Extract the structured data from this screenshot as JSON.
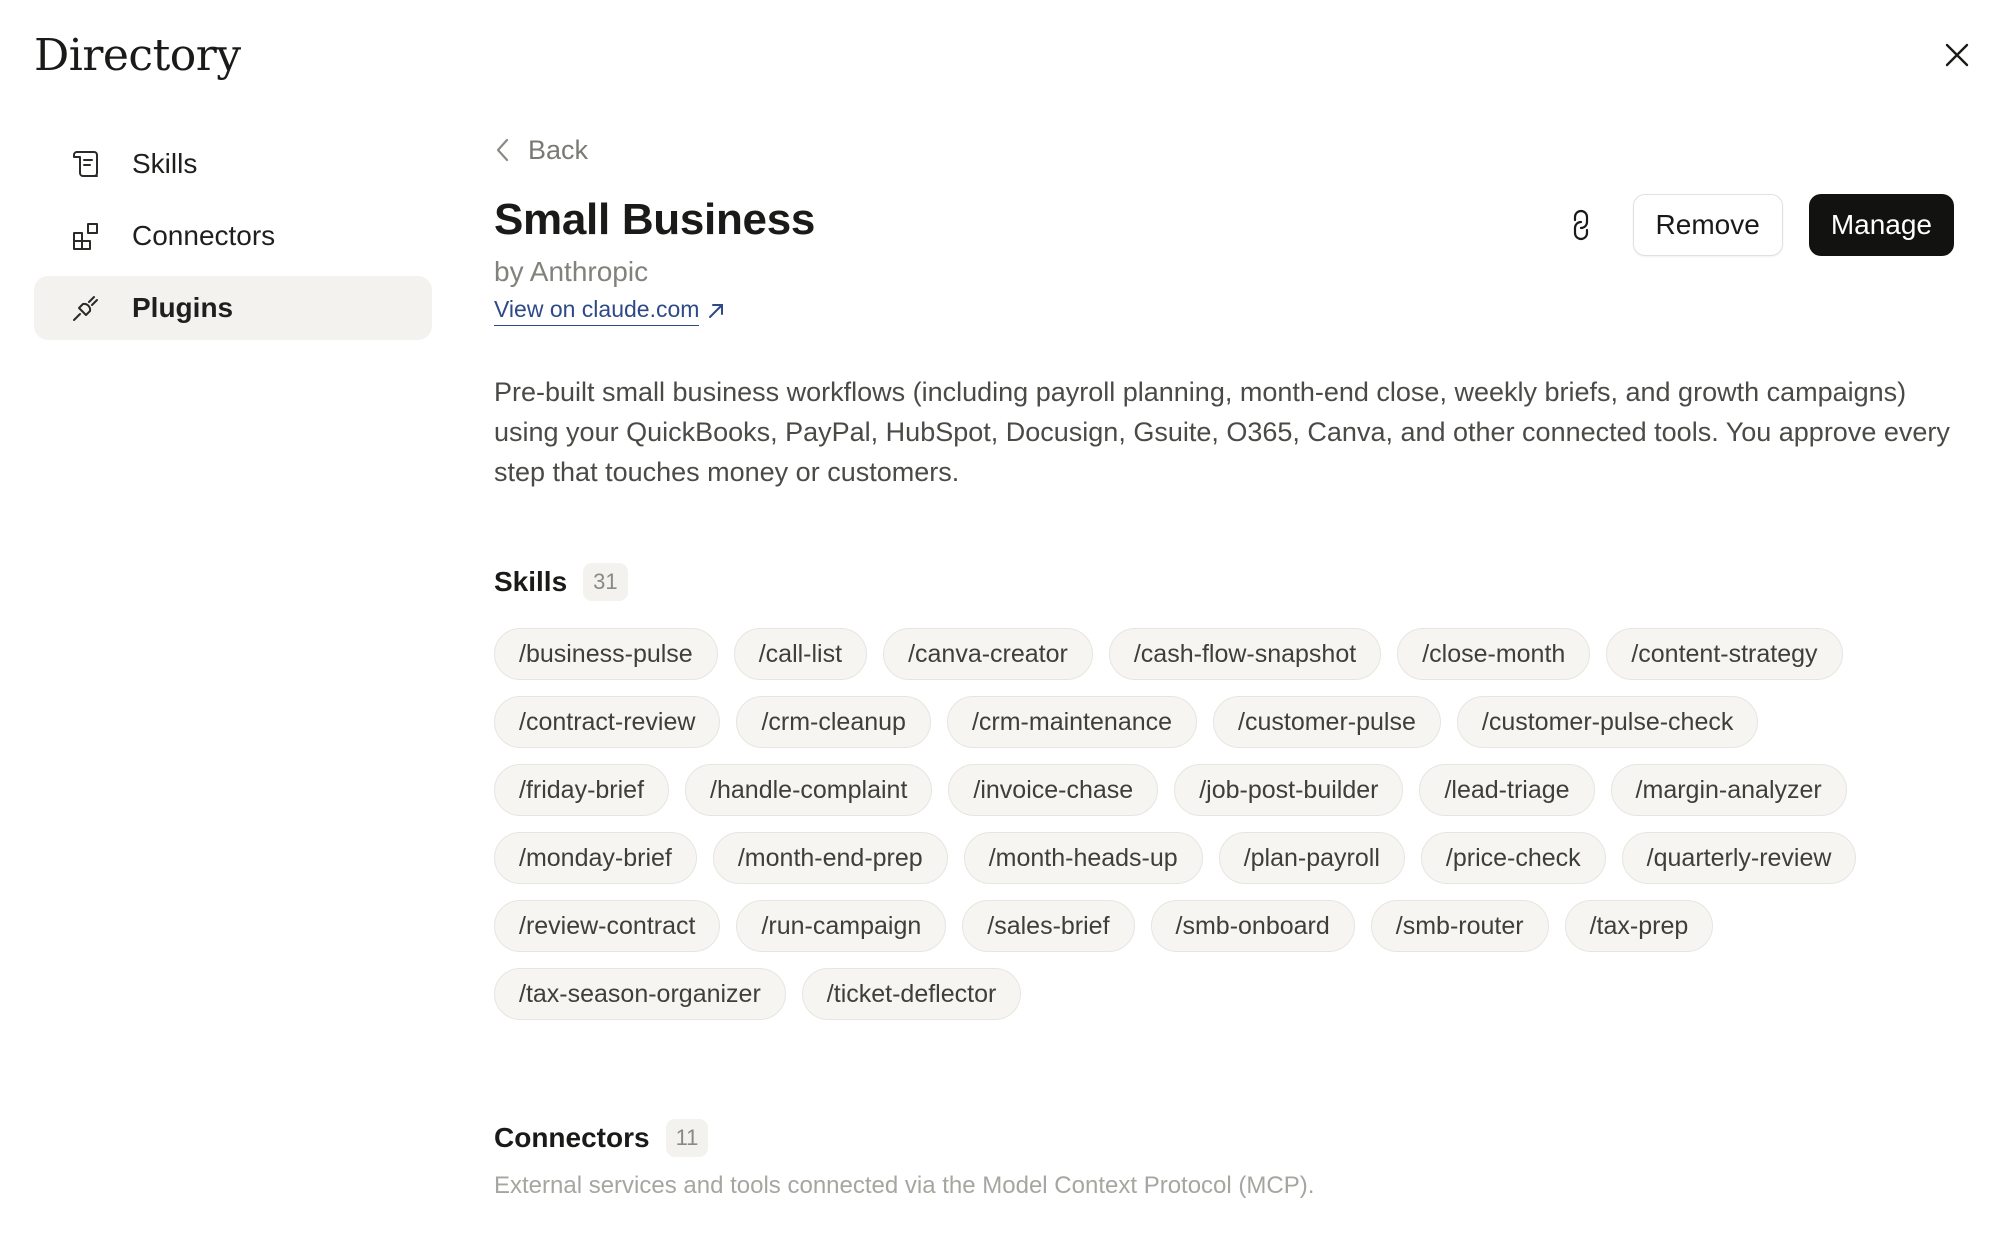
{
  "header": {
    "title": "Directory",
    "close_icon": "close-icon"
  },
  "sidebar": {
    "items": [
      {
        "label": "Skills",
        "icon": "scroll-icon",
        "active": false
      },
      {
        "label": "Connectors",
        "icon": "blocks-icon",
        "active": false
      },
      {
        "label": "Plugins",
        "icon": "plug-icon",
        "active": true
      }
    ]
  },
  "main": {
    "back_label": "Back",
    "title": "Small Business",
    "byline": "by Anthropic",
    "link_label": "View on claude.com",
    "actions": {
      "copy_link_icon": "link-icon",
      "remove_label": "Remove",
      "manage_label": "Manage"
    },
    "description": "Pre-built small business workflows (including payroll planning, month-end close, weekly briefs, and growth campaigns) using your QuickBooks, PayPal, HubSpot, Docusign, Gsuite, O365, Canva, and other connected tools. You approve every step that touches money or customers.",
    "skills": {
      "label": "Skills",
      "count": "31",
      "items": [
        "/business-pulse",
        "/call-list",
        "/canva-creator",
        "/cash-flow-snapshot",
        "/close-month",
        "/content-strategy",
        "/contract-review",
        "/crm-cleanup",
        "/crm-maintenance",
        "/customer-pulse",
        "/customer-pulse-check",
        "/friday-brief",
        "/handle-complaint",
        "/invoice-chase",
        "/job-post-builder",
        "/lead-triage",
        "/margin-analyzer",
        "/monday-brief",
        "/month-end-prep",
        "/month-heads-up",
        "/plan-payroll",
        "/price-check",
        "/quarterly-review",
        "/review-contract",
        "/run-campaign",
        "/sales-brief",
        "/smb-onboard",
        "/smb-router",
        "/tax-prep",
        "/tax-season-organizer",
        "/ticket-deflector"
      ]
    },
    "connectors": {
      "label": "Connectors",
      "count": "11",
      "subtitle": "External services and tools connected via the Model Context Protocol (MCP)."
    }
  },
  "colors": {
    "accent_dark": "#121211",
    "link_blue": "#2e4a86",
    "chip_bg": "#f6f5f2",
    "active_bg": "#f3f2ef"
  }
}
